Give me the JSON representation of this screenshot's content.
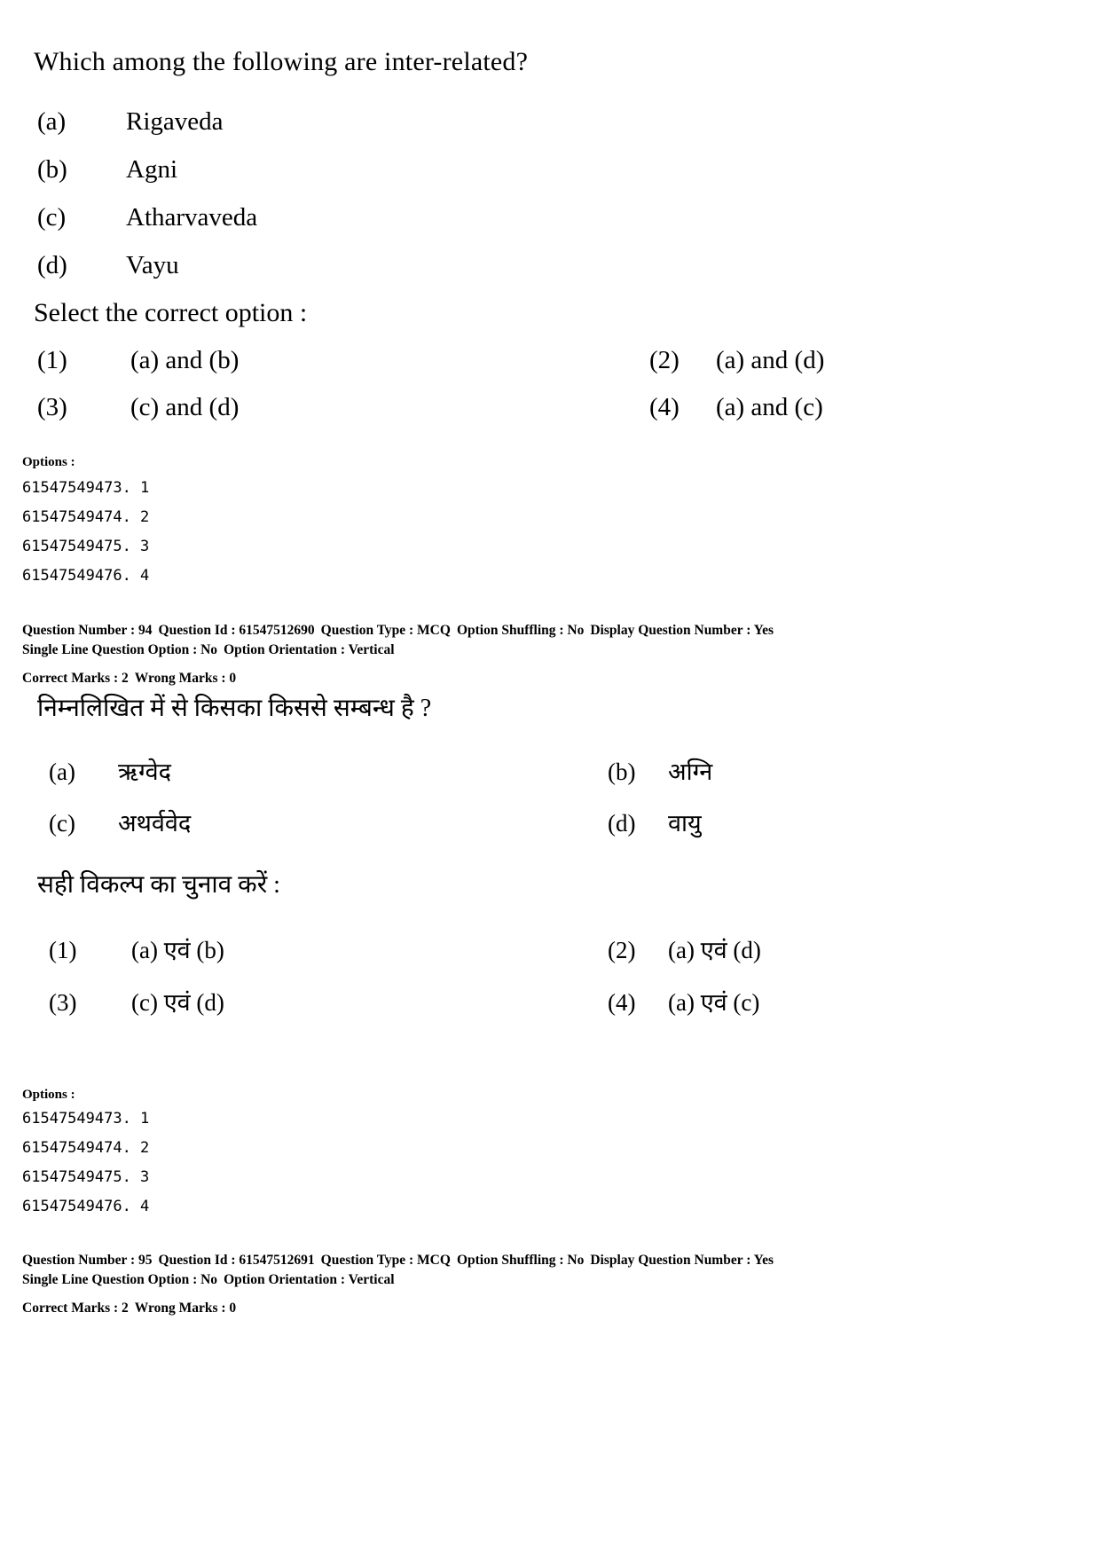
{
  "question_en": {
    "stem": "Which among the following are inter-related?",
    "items": [
      {
        "label": "(a)",
        "text": "Rigaveda"
      },
      {
        "label": "(b)",
        "text": "Agni"
      },
      {
        "label": "(c)",
        "text": "Atharvaveda"
      },
      {
        "label": "(d)",
        "text": "Vayu"
      }
    ],
    "select_prompt": "Select the correct option :",
    "choices": [
      {
        "num": "(1)",
        "text": "(a) and (b)"
      },
      {
        "num": "(2)",
        "text": "(a) and (d)"
      },
      {
        "num": "(3)",
        "text": "(c) and (d)"
      },
      {
        "num": "(4)",
        "text": "(a) and (c)"
      }
    ]
  },
  "options_block_1": {
    "label": "Options :",
    "ids": [
      "61547549473. 1",
      "61547549474. 2",
      "61547549475. 3",
      "61547549476. 4"
    ]
  },
  "meta_1": {
    "line1": [
      "Question Number : 94",
      "Question Id : 61547512690",
      "Question Type : MCQ",
      "Option Shuffling : No",
      "Display Question Number : Yes"
    ],
    "line2": [
      "Single Line Question Option : No",
      "Option Orientation : Vertical"
    ],
    "line3": [
      "Correct Marks : 2",
      "Wrong Marks : 0"
    ]
  },
  "question_hi": {
    "stem": "निम्नलिखित में से किसका किससे सम्बन्ध है ?",
    "items": [
      {
        "label": "(a)",
        "text": "ऋग्वेद"
      },
      {
        "label": "(b)",
        "text": "अग्नि"
      },
      {
        "label": "(c)",
        "text": "अथर्ववेद"
      },
      {
        "label": "(d)",
        "text": "वायु"
      }
    ],
    "select_prompt": "सही विकल्प का चुनाव करें :",
    "choices": [
      {
        "num": "(1)",
        "text": "(a) एवं (b)"
      },
      {
        "num": "(2)",
        "text": "(a) एवं (d)"
      },
      {
        "num": "(3)",
        "text": "(c) एवं (d)"
      },
      {
        "num": "(4)",
        "text": "(a) एवं (c)"
      }
    ]
  },
  "options_block_2": {
    "label": "Options :",
    "ids": [
      "61547549473. 1",
      "61547549474. 2",
      "61547549475. 3",
      "61547549476. 4"
    ]
  },
  "meta_2": {
    "line1": [
      "Question Number : 95",
      "Question Id : 61547512691",
      "Question Type : MCQ",
      "Option Shuffling : No",
      "Display Question Number : Yes"
    ],
    "line2": [
      "Single Line Question Option : No",
      "Option Orientation : Vertical"
    ],
    "line3": [
      "Correct Marks : 2",
      "Wrong Marks : 0"
    ]
  }
}
